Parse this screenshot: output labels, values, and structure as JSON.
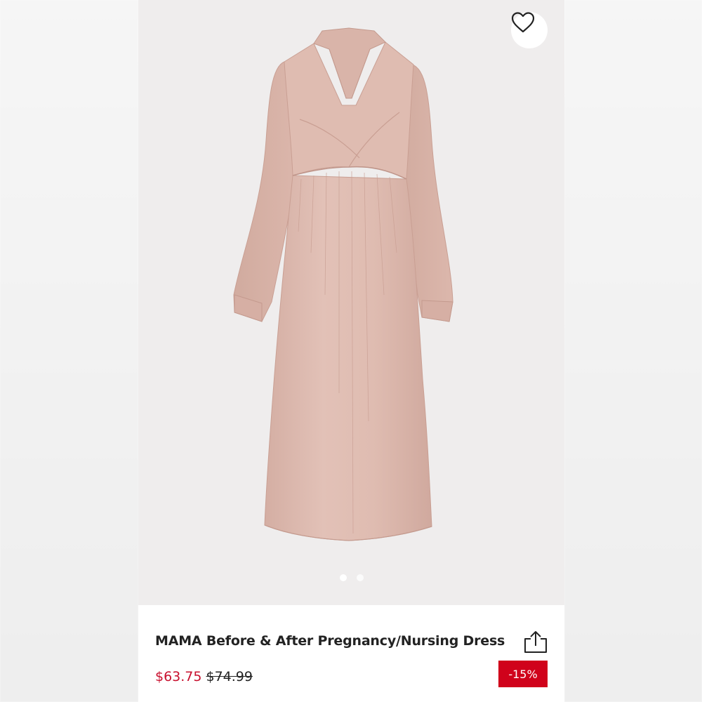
{
  "product": {
    "title": "MAMA Before & After Pregnancy/Nursing Dress",
    "price_current": "$63.75",
    "price_original": "$74.99",
    "discount_badge": "-15%"
  },
  "gallery": {
    "image_count": 2,
    "active_index": 0
  },
  "icons": {
    "favorite": "heart-outline-icon",
    "share": "share-icon"
  },
  "colors": {
    "sale_price": "#c8102e",
    "badge_background": "#d0021b",
    "dress": "#ddb9ae",
    "photo_background": "#efeded"
  }
}
